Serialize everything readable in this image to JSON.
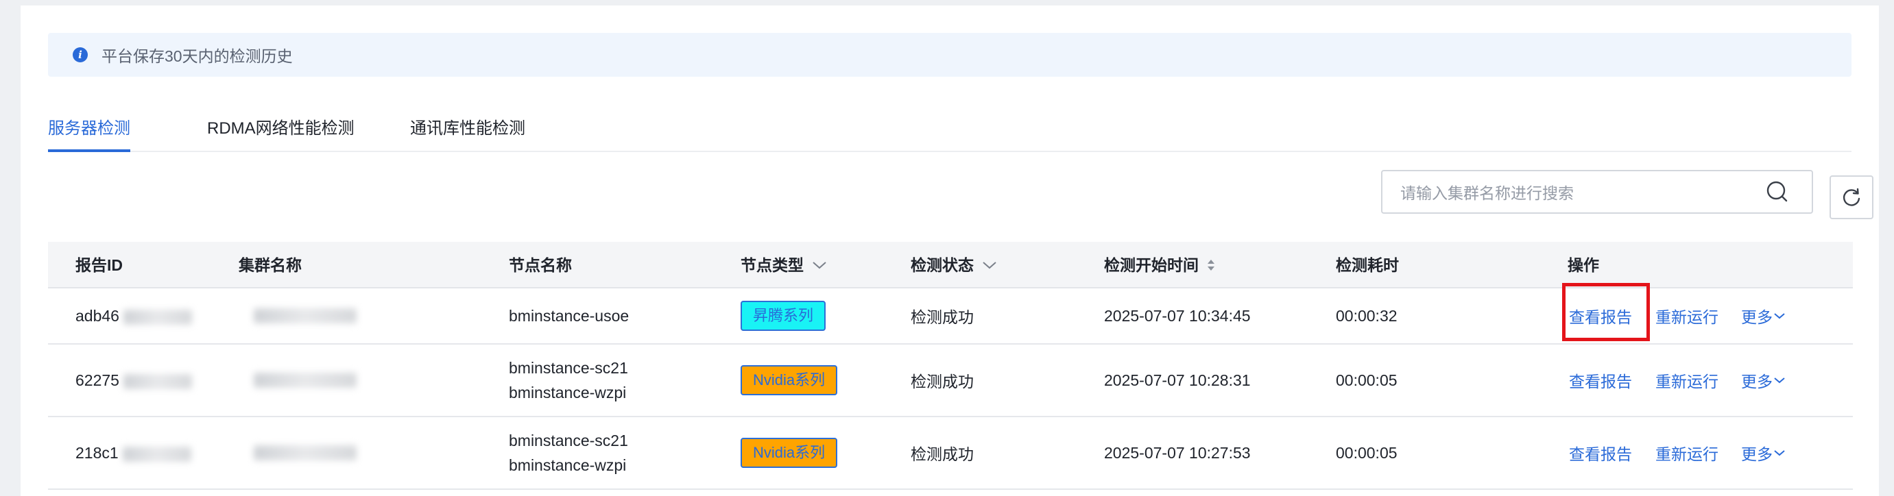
{
  "notice": {
    "text": "平台保存30天内的检测历史"
  },
  "tabs": [
    {
      "label": "服务器检测",
      "active": true
    },
    {
      "label": "RDMA网络性能检测",
      "active": false
    },
    {
      "label": "通讯库性能检测",
      "active": false
    }
  ],
  "search": {
    "placeholder": "请输入集群名称进行搜索"
  },
  "table": {
    "headers": {
      "report_id": "报告ID",
      "cluster": "集群名称",
      "node_name": "节点名称",
      "node_type": "节点类型",
      "status": "检测状态",
      "start_time": "检测开始时间",
      "duration": "检测耗时",
      "actions": "操作"
    },
    "rows": [
      {
        "report_id": "adb46",
        "nodes": [
          "bminstance-usoe"
        ],
        "node_type": "昇腾系列",
        "status": "检测成功",
        "start_time": "2025-07-07 10:34:45",
        "duration": "00:00:32"
      },
      {
        "report_id": "62275",
        "nodes": [
          "bminstance-sc21",
          "bminstance-wzpi"
        ],
        "node_type": "Nvidia系列",
        "status": "检测成功",
        "start_time": "2025-07-07 10:28:31",
        "duration": "00:00:05"
      },
      {
        "report_id": "218c1",
        "nodes": [
          "bminstance-sc21",
          "bminstance-wzpi"
        ],
        "node_type": "Nvidia系列",
        "status": "检测成功",
        "start_time": "2025-07-07 10:27:53",
        "duration": "00:00:05"
      }
    ],
    "actions": {
      "view": "查看报告",
      "rerun": "重新运行",
      "more": "更多"
    }
  },
  "colors": {
    "accent": "#2a6ad8",
    "ascend_tag": "#19f3f5",
    "nvidia_tag": "#ffa400",
    "highlight": "#e4141a"
  }
}
